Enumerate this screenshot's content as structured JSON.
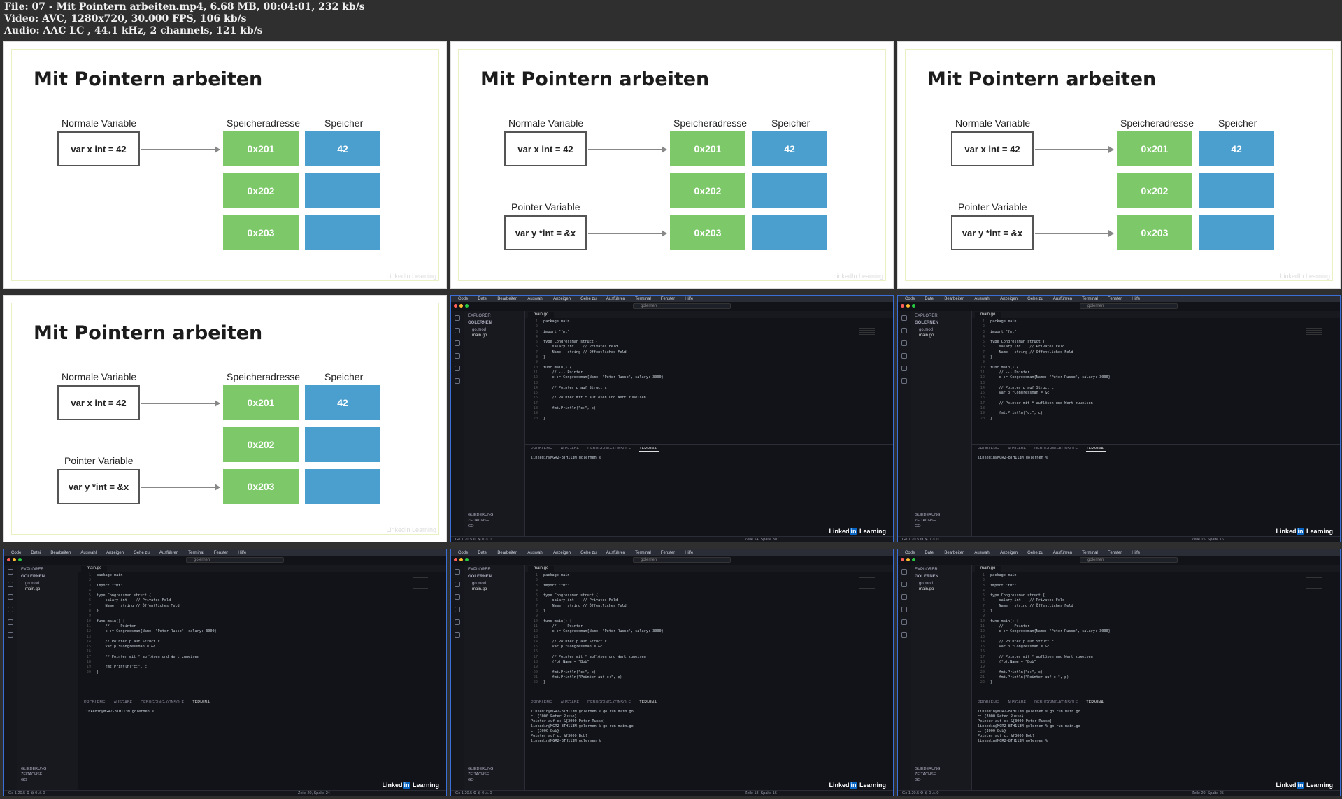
{
  "header": {
    "file": "File: 07 - Mit Pointern arbeiten.mp4, 6.68 MB, 00:04:01, 232 kb/s",
    "video": "Video: AVC, 1280x720, 30.000 FPS, 106 kb/s",
    "audio": "Audio: AAC LC , 44.1 kHz, 2 channels, 121 kb/s"
  },
  "slide": {
    "title": "Mit Pointern arbeiten",
    "normal_label": "Normale Variable",
    "pointer_label": "Pointer Variable",
    "addr_label": "Speicheradresse",
    "mem_label": "Speicher",
    "var_x": "var x int = 42",
    "var_y": "var y *int = &x",
    "addrs": [
      "0x201",
      "0x202",
      "0x203"
    ],
    "mem_value": "42",
    "watermark": "LinkedIn Learning"
  },
  "editor": {
    "menu": [
      "Code",
      "Datei",
      "Bearbeiten",
      "Auswahl",
      "Anzeigen",
      "Gehe zu",
      "Ausführen",
      "Terminal",
      "Fenster",
      "Hilfe"
    ],
    "search": "golernen",
    "explorer_title": "EXPLORER",
    "folder": "GOLERNEN",
    "files": [
      "go.mod",
      "main.go"
    ],
    "outline": [
      "GLIEDERUNG",
      "ZEITACHSE",
      "GO"
    ],
    "tab": "main.go",
    "panel_tabs": [
      "PROBLEME",
      "AUSGABE",
      "DEBUGGING-KONSOLE",
      "TERMINAL"
    ],
    "status_left": "Go 1.20.5 ⚙   ⊗ 0 ⚠ 0",
    "brand_left": "Linked",
    "brand_in": "in",
    "brand_right": " Learning",
    "code": [
      "package main",
      "",
      "import \"fmt\"",
      "",
      "type Congressman struct {",
      "    salary int    // Privates Feld",
      "    Name   string // Öffentliches Feld",
      "}",
      "",
      "func main() {",
      "    // --- Pointer",
      "    c := Congressman{Name: \"Peter Russo\", salary: 3000}",
      "",
      "    // Pointer p auf Struct c",
      "    var p *Congressman = &c",
      "",
      "    // Pointer mit * auflösen und Wert zuweisen",
      "    (*p).Name = \"Bob\"",
      "",
      "    fmt.Println(\"c:\", c)",
      "    fmt.Println(\"Pointer auf c:\", p)",
      "}"
    ],
    "term1": "linkedin@MGR2-8TH113M golernen % ",
    "term2": "linkedin@MGR2-8TH113M golernen % go run main.go\nc: {3000 Peter Russo}\nPointer auf c: &{3000 Peter Russo}\nlinkedin@MGR2-8TH113M golernen % go run main.go\nc: {3000 Bob}\nPointer auf c: &{3000 Bob}\nlinkedin@MGR2-8TH113M golernen % ",
    "status_pos": [
      "Zeile 14, Spalte 30",
      "Zeile 15, Spalte 16",
      "Zeile 20, Spalte 24",
      "Zeile 18, Spalte 16",
      "Zeile 20, Spalte 25"
    ]
  }
}
